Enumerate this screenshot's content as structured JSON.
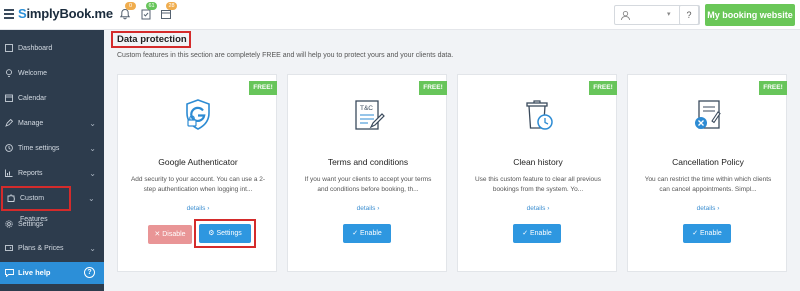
{
  "header": {
    "logo_prefix": "S",
    "logo_rest": "implyBook.me",
    "notif_badges": [
      "0",
      "61",
      "28"
    ],
    "help_label": "?",
    "my_site_label": "My booking website"
  },
  "sidebar": {
    "items": [
      {
        "label": "Dashboard"
      },
      {
        "label": "Welcome"
      },
      {
        "label": "Calendar"
      },
      {
        "label": "Manage",
        "chevron": "⌄"
      },
      {
        "label": "Time settings",
        "chevron": "⌄"
      },
      {
        "label": "Reports",
        "chevron": "⌄"
      },
      {
        "label": "Custom Features",
        "chevron": "⌄"
      },
      {
        "label": "Settings"
      },
      {
        "label": "Plans & Prices",
        "chevron": "⌄"
      }
    ],
    "live_help": "Live help",
    "live_help_icon": "?"
  },
  "main": {
    "title": "Data protection",
    "description": "Custom features in this section are completely FREE and will help you to protect yours and your clients data.",
    "cards": [
      {
        "ribbon": "FREE!",
        "title": "Google Authenticator",
        "desc": "Add security to your account. You can use a 2-step authentication when logging int...",
        "details": "details ›",
        "disable_label": "✕ Disable",
        "settings_label": "⚙ Settings"
      },
      {
        "ribbon": "FREE!",
        "title": "Terms and conditions",
        "desc": "If you want your clients to accept your terms and conditions before booking, th...",
        "details": "details ›",
        "enable_label": "✓ Enable",
        "icon_text": "T&C"
      },
      {
        "ribbon": "FREE!",
        "title": "Clean history",
        "desc": "Use this custom feature to clear all previous bookings from the system. Yo...",
        "details": "details ›",
        "enable_label": "✓ Enable"
      },
      {
        "ribbon": "FREE!",
        "title": "Cancellation Policy",
        "desc": "You can restrict the time within which clients can cancel appointments. Simpl...",
        "details": "details ›",
        "enable_label": "✓ Enable"
      }
    ]
  },
  "colors": {
    "accent_blue": "#2e97e0",
    "free_green": "#67c55a",
    "highlight_red": "#d42b2b",
    "sidebar_bg": "#2d3c4d",
    "disable_pink": "#e99596"
  }
}
